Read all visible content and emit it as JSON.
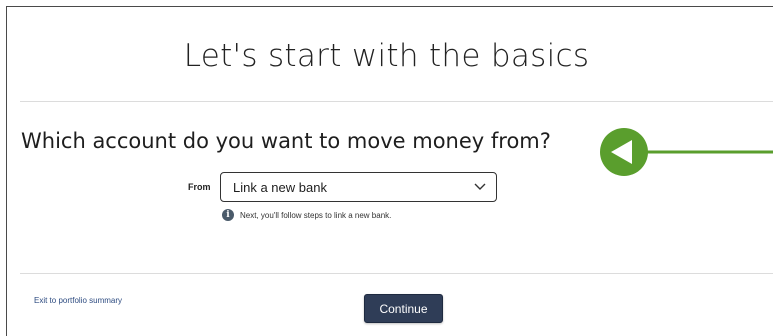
{
  "title": "Let's start with the basics",
  "question": "Which account do you want to move money from?",
  "from": {
    "label": "From",
    "selected": "Link a new bank",
    "hint": "Next, you'll follow steps to link a new bank.",
    "hint_icon": "info-icon"
  },
  "footer": {
    "exit_link": "Exit to portfolio summary",
    "continue_label": "Continue"
  },
  "colors": {
    "button": "#2f3d57",
    "link": "#2d4b80",
    "annotation_arrow": "#5a9e2d"
  },
  "annotation": {
    "icon": "pointer-arrow-icon",
    "direction": "left"
  }
}
